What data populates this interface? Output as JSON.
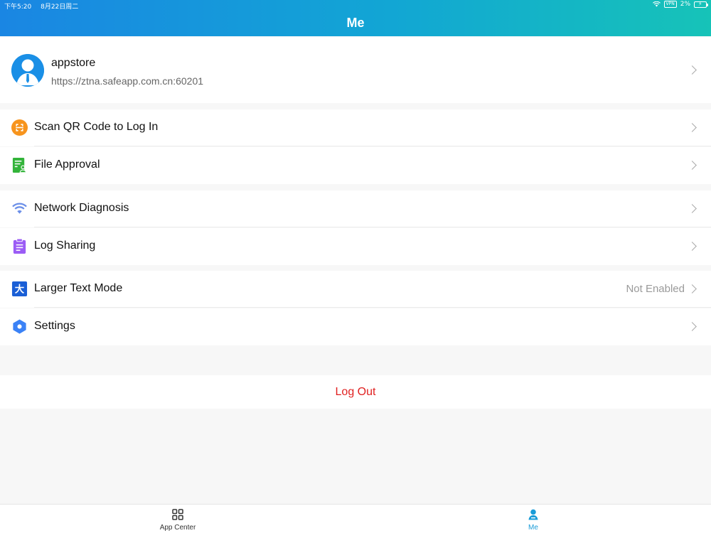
{
  "status_bar": {
    "time": "下午5:20",
    "date": "8月22日周二",
    "vpn": "VPN",
    "battery": "2%"
  },
  "header": {
    "title": "Me"
  },
  "profile": {
    "name": "appstore",
    "url": "https://ztna.safeapp.com.cn:60201"
  },
  "menu": {
    "scan_qr": {
      "label": "Scan QR Code to Log In",
      "icon": "qr-scan-icon",
      "color": "#f7941d"
    },
    "file_approval": {
      "label": "File Approval",
      "icon": "file-approval-icon",
      "color": "#33b43a"
    },
    "network_diagnosis": {
      "label": "Network Diagnosis",
      "icon": "wifi-icon",
      "color": "#6b8fe8"
    },
    "log_sharing": {
      "label": "Log Sharing",
      "icon": "clipboard-icon",
      "color": "#9b5cf5"
    },
    "larger_text": {
      "label": "Larger Text Mode",
      "value": "Not Enabled",
      "icon": "large-text-icon",
      "icon_glyph": "大",
      "color": "#1a5fd6"
    },
    "settings": {
      "label": "Settings",
      "icon": "settings-hex-icon",
      "color": "#3b82f6"
    }
  },
  "logout": {
    "label": "Log Out",
    "color": "#e02020"
  },
  "tabbar": {
    "tabs": [
      {
        "label": "App Center",
        "icon": "grid-icon",
        "active": false
      },
      {
        "label": "Me",
        "icon": "person-icon",
        "active": true
      }
    ]
  }
}
